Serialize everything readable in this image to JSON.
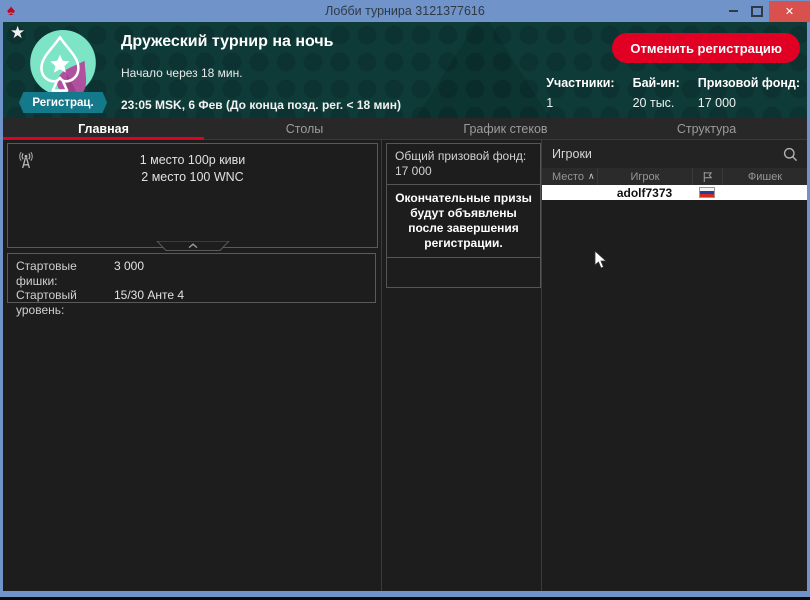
{
  "window": {
    "title": "Лобби турнира 3121377616",
    "close_glyph": "✕"
  },
  "header": {
    "status_badge": "Регистрац.",
    "title": "Дружеский турнир на ночь",
    "starts_in": "Начало через 18 мин.",
    "schedule": "23:05 MSK, 6 Фев (До конца позд. рег. < 18 мин)",
    "cancel_registration": "Отменить регистрацию",
    "stats": [
      {
        "label": "Участники:",
        "value": "1"
      },
      {
        "label": "Бай-ин:",
        "value": "20 тыс."
      },
      {
        "label": "Призовой фонд:",
        "value": "17 000"
      }
    ]
  },
  "tabs": [
    {
      "label": "Главная"
    },
    {
      "label": "Столы"
    },
    {
      "label": "График стеков"
    },
    {
      "label": "Структура"
    }
  ],
  "prizes": {
    "line1": "1 место 100р киви",
    "line2": "2 место 100 WNC"
  },
  "start_info": {
    "chips_label": "Стартовые фишки:",
    "chips_value": "3 000",
    "level_label": "Стартовый уровень:",
    "level_value": "15/30 Анте 4"
  },
  "prize_pool": {
    "label": "Общий призовой фонд:",
    "value": "17 000",
    "note": "Окончательные призы будут объявлены после завершения регистрации."
  },
  "players": {
    "search_placeholder": "Игроки",
    "col_place": "Место",
    "col_player": "Игрок",
    "col_chips": "Фишек",
    "sort_glyph": "∧",
    "rows": [
      {
        "place": "",
        "player": "adolf7373",
        "chips": "",
        "flag": "ru"
      }
    ]
  }
}
